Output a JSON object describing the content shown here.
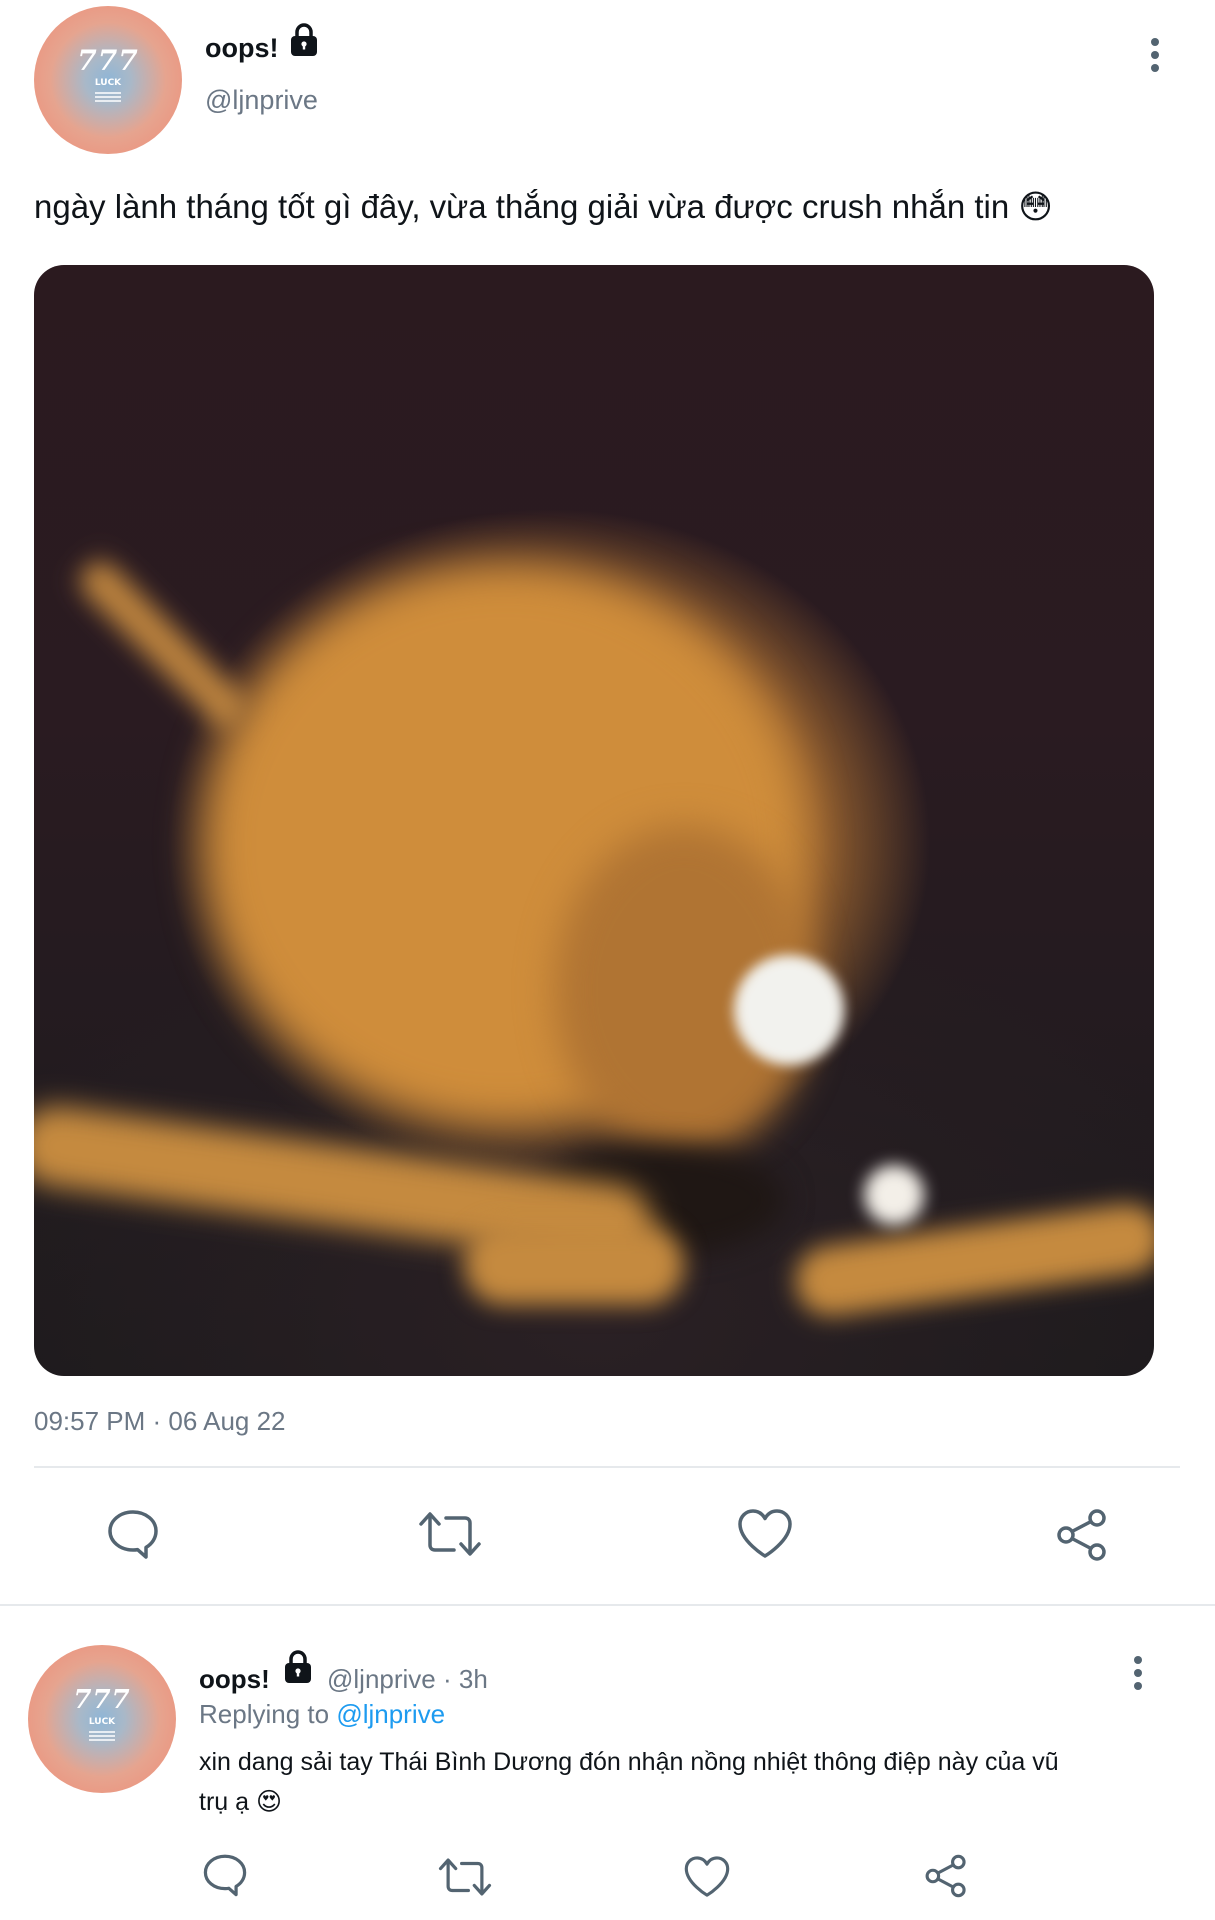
{
  "tweet": {
    "avatar": {
      "title": "777",
      "subtitle": "LUCK"
    },
    "display_name": "oops!",
    "handle": "@ljnprive",
    "text": "ngày lành tháng tốt gì đây, vừa thắng giải vừa được crush nhắn tin",
    "emoji": "😳",
    "timestamp": "09:57 PM · 06 Aug 22"
  },
  "actions": [
    "reply-icon",
    "retweet-icon",
    "like-icon",
    "share-icon"
  ],
  "reply": {
    "avatar": {
      "title": "777",
      "subtitle": "LUCK"
    },
    "display_name": "oops!",
    "handle": "@ljnprive",
    "time": "· 3h",
    "replying_prefix": "Replying to",
    "replying_to": "@ljnprive",
    "text_line1": "xin dang sải tay Thái Bình Dương đón nhận nồng nhiệt thông điệp này của vũ",
    "text_line2": "trụ ạ",
    "emoji": "😍"
  },
  "colors": {
    "text": "#0f1419",
    "secondary": "#6b7785",
    "link": "#1d9bf0",
    "divider": "#e6e9ec",
    "icon": "#536471"
  }
}
